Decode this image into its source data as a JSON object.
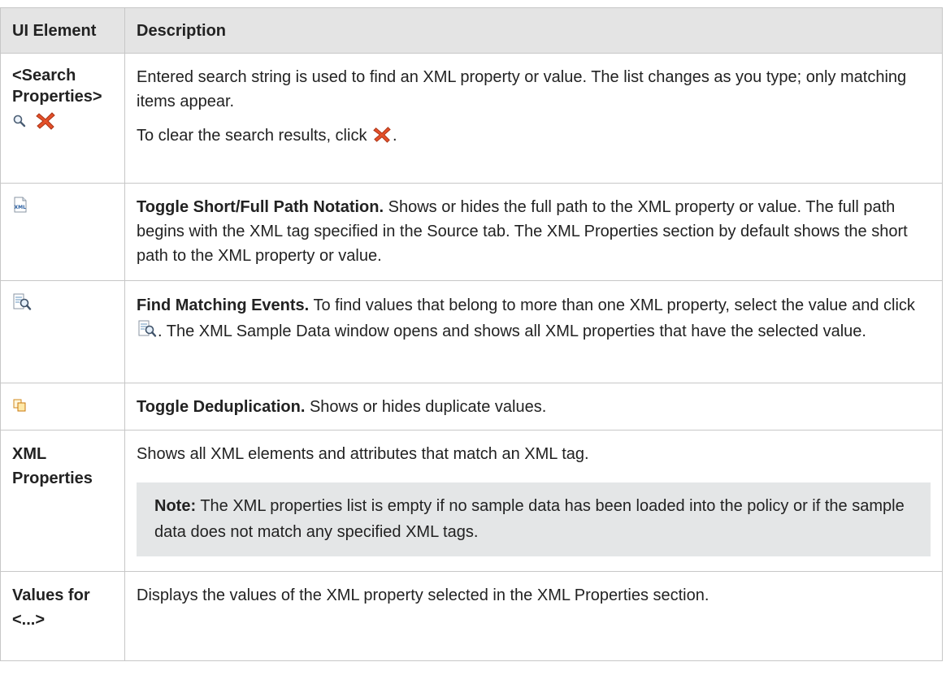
{
  "table": {
    "headers": {
      "element": "UI Element",
      "description": "Description"
    },
    "rows": [
      {
        "element_label": "<Search Properties>",
        "element_icons": [
          "search-icon",
          "clear-x-icon"
        ],
        "paragraphs": [
          "Entered search string is used to find an XML property or value. The list changes as you type; only matching items appear.",
          "To clear the search results, click"
        ],
        "trailing": "."
      },
      {
        "element_icon": "xml-path-icon",
        "title": "Toggle Short/Full Path Notation.",
        "text": "Shows or hides the full path to the XML property or value. The full path begins with the XML tag specified in the Source tab. The XML Properties section by default shows the short path to the XML property or value."
      },
      {
        "element_icon": "find-matching-events-icon",
        "title": "Find Matching Events.",
        "text_before_icon": "To find values that belong to more than one XML property, select the value and click",
        "text_after_icon": ". The XML Sample Data window opens and shows all XML properties that have the selected value."
      },
      {
        "element_icon": "dedup-icon",
        "title": "Toggle Deduplication.",
        "text": "Shows or hides duplicate values."
      },
      {
        "element_label": "XML Properties",
        "text": "Shows all XML elements and attributes that match an XML tag.",
        "note_label": "Note:",
        "note_text": "The XML properties list is empty if no sample data has been loaded into the policy or if the sample data does not match any specified XML tags."
      },
      {
        "element_label": "Values for <...>",
        "text": "Displays the values of the XML property selected in the XML Properties section."
      }
    ]
  }
}
